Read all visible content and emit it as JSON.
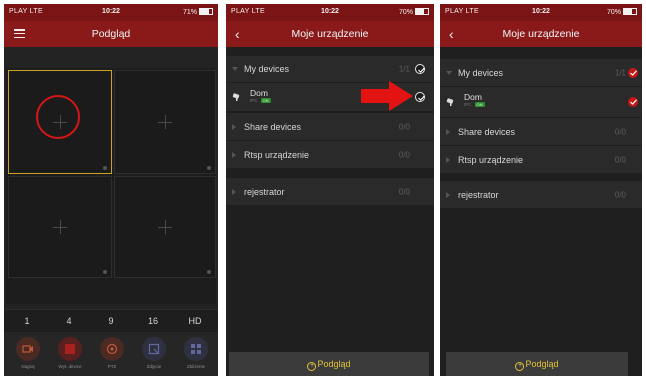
{
  "colors": {
    "status_bar": "#7b1515",
    "title_bar": "#8a1a1a",
    "accent_red": "#d41616",
    "selection_yellow": "#c9a227",
    "preview_button_text": "#e3c23c",
    "online_green": "#2e8b2e"
  },
  "status": {
    "carrier": "PLAY  LTE",
    "time": "10:22",
    "battery_phone1": "71%",
    "battery_phone2": "70%",
    "battery_phone3": "70%",
    "battery_level_phone1": 0.71,
    "battery_level_phone2": 0.7,
    "battery_level_phone3": 0.7
  },
  "phone1": {
    "title": "Podgląd",
    "menu_icon": "hamburger-icon",
    "split_options": [
      "1",
      "4",
      "9",
      "16",
      "HD"
    ],
    "tools": [
      {
        "icon": "record-icon",
        "label": "Nagraj"
      },
      {
        "icon": "close-device-icon",
        "label": "Wył. device"
      },
      {
        "icon": "ptz-icon",
        "label": "PTZ"
      },
      {
        "icon": "photo-icon",
        "label": "Zdjęcie"
      },
      {
        "icon": "zoom-icon",
        "label": "Zbliżenie"
      }
    ]
  },
  "phone2": {
    "title": "Moje urządzenie",
    "back_icon": "chevron-left-icon",
    "my_devices": {
      "label": "My devices",
      "count": "1/1"
    },
    "device": {
      "name": "Dom",
      "type": "IPC",
      "status": "ON"
    },
    "share_devices": {
      "label": "Share devices",
      "count": "0/0"
    },
    "rtsp": {
      "label": "Rtsp urządzenie",
      "count": "0/0"
    },
    "recorder": {
      "label": "rejestrator",
      "count": "0/0"
    },
    "preview_button": "Podgląd"
  },
  "phone3": {
    "title": "Moje urządzenie",
    "back_icon": "chevron-left-icon",
    "my_devices": {
      "label": "My devices",
      "count": "1/1"
    },
    "device": {
      "name": "Dom",
      "type": "IPC",
      "status": "ON"
    },
    "share_devices": {
      "label": "Share devices",
      "count": "0/0"
    },
    "rtsp": {
      "label": "Rtsp urządzenie",
      "count": "0/0"
    },
    "recorder": {
      "label": "rejestrator",
      "count": "0/0"
    },
    "preview_button": "Podgląd"
  }
}
